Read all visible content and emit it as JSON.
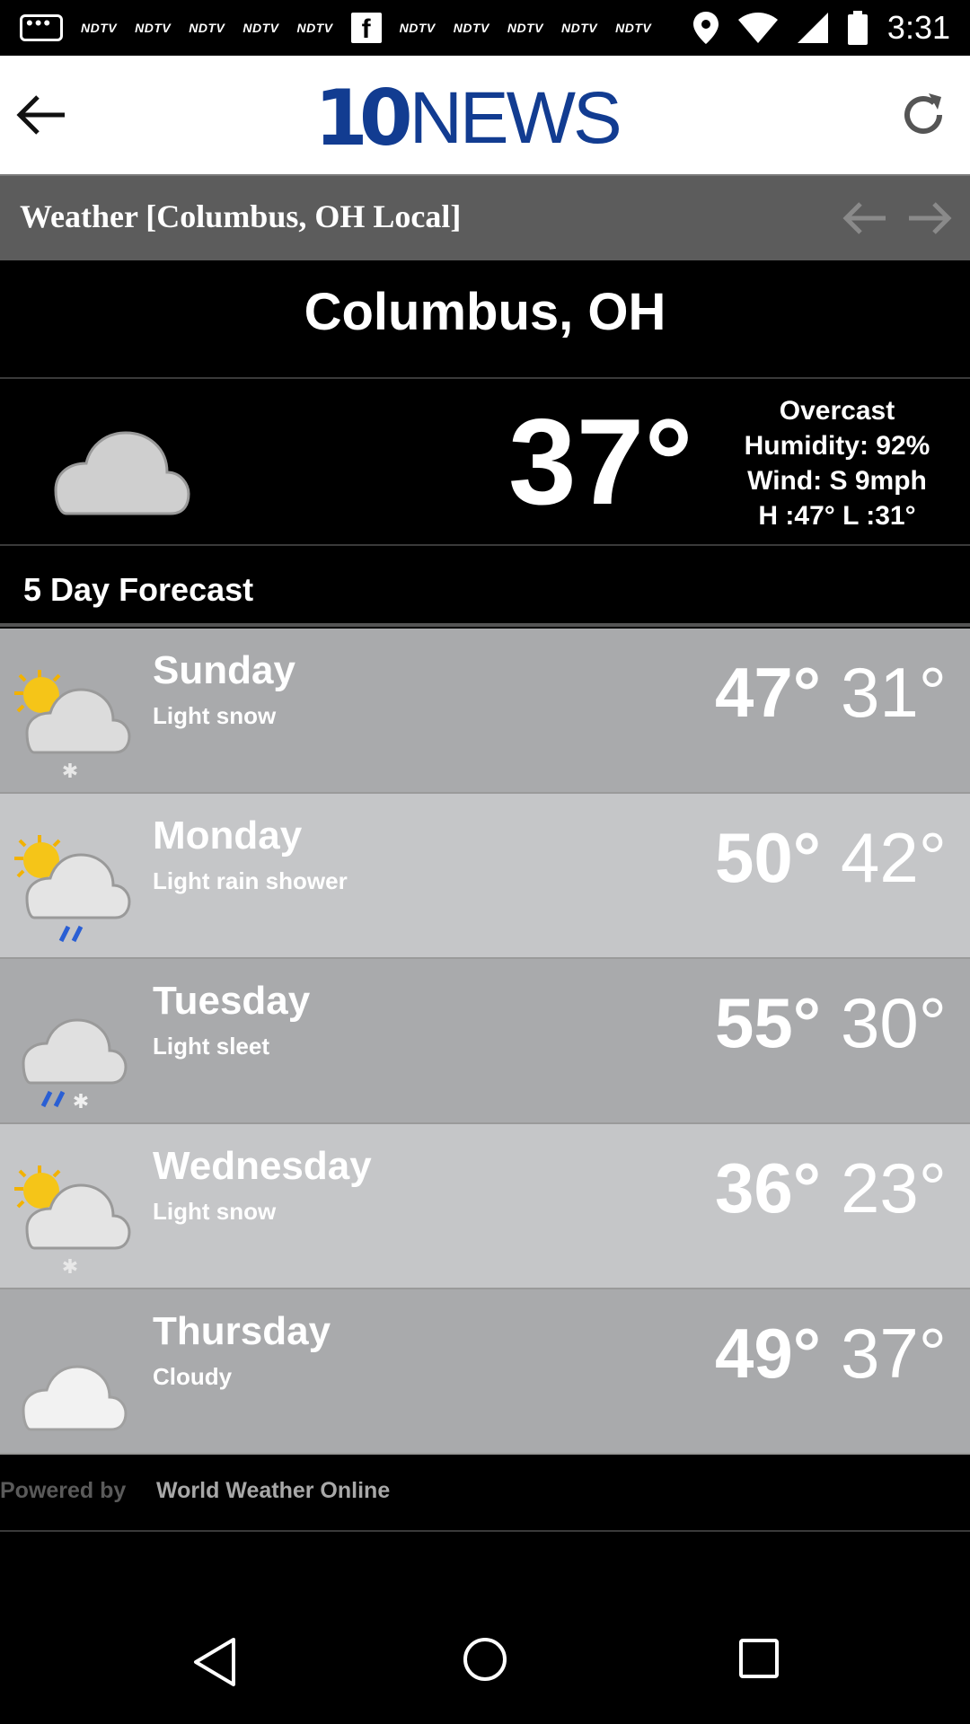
{
  "status_bar": {
    "notifications": [
      "NDTV",
      "NDTV",
      "NDTV",
      "NDTV",
      "NDTV",
      "NDTV",
      "NDTV",
      "NDTV",
      "NDTV",
      "NDTV"
    ],
    "time": "3:31"
  },
  "app_bar": {
    "logo_number": "10",
    "logo_text": "NEWS",
    "logo_color": "#123c91"
  },
  "title_bar": {
    "title": "Weather [Columbus, OH Local]"
  },
  "location": {
    "city": "Columbus, OH"
  },
  "current": {
    "icon": "cloud-icon",
    "temperature": "37°",
    "condition": "Overcast",
    "humidity": "Humidity: 92%",
    "wind": "Wind: S 9mph",
    "high_low": "H :47°   L :31°"
  },
  "forecast": {
    "heading": "5 Day Forecast",
    "days": [
      {
        "day": "Sunday",
        "condition": "Light snow",
        "high": "47°",
        "low": "31°",
        "icon": "partly-cloudy-snow-icon"
      },
      {
        "day": "Monday",
        "condition": "Light rain shower",
        "high": "50°",
        "low": "42°",
        "icon": "partly-cloudy-rain-icon"
      },
      {
        "day": "Tuesday",
        "condition": "Light sleet",
        "high": "55°",
        "low": "30°",
        "icon": "cloud-sleet-icon"
      },
      {
        "day": "Wednesday",
        "condition": "Light snow",
        "high": "36°",
        "low": "23°",
        "icon": "partly-cloudy-snow-icon"
      },
      {
        "day": "Thursday",
        "condition": "Cloudy",
        "high": "49°",
        "low": "37°",
        "icon": "cloud-icon"
      }
    ]
  },
  "footer": {
    "powered_label": "Powered by",
    "source": "World Weather Online"
  }
}
